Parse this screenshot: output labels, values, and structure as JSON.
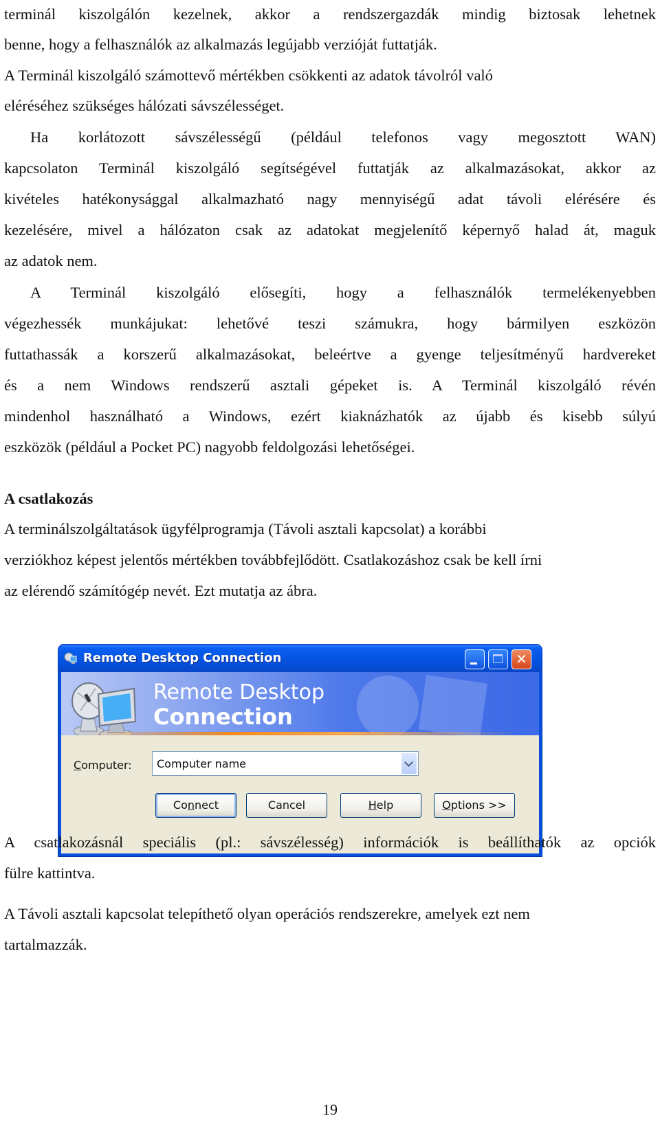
{
  "document": {
    "lines": [
      "terminál kiszolgálón kezelnek, akkor a rendszergazdák mindig biztosak lehetnek",
      "benne, hogy a felhasználók az alkalmazás legújabb verzióját futtatják.",
      "A Terminál kiszolgáló számottevő mértékben csökkenti az adatok távolról való",
      "eléréséhez szükséges hálózati sávszélességet.",
      "Ha korlátozott sávszélességű (például telefonos vagy megosztott WAN)",
      "kapcsolaton Terminál kiszolgáló segítségével futtatják az alkalmazásokat, akkor az",
      "kivételes hatékonysággal alkalmazható nagy mennyiségű adat távoli elérésére és",
      "kezelésére, mivel a hálózaton csak az adatokat megjelenítő képernyő halad át, maguk",
      "az adatok nem.",
      "A Terminál kiszolgáló elősegíti, hogy a felhasználók termelékenyebben",
      "végezhessék munkájukat: lehetővé teszi számukra, hogy bármilyen eszközön",
      "futtathassák a korszerű alkalmazásokat, beleértve a gyenge teljesítményű hardvereket",
      "és a nem Windows rendszerű asztali gépeket is. A Terminál kiszolgáló révén",
      "mindenhol használható a Windows, ezért kiaknázhatók az újabb és kisebb súlyú",
      "eszközök (például a Pocket PC) nagyobb feldolgozási lehetőségei."
    ],
    "section_heading": "A csatlakozás",
    "section_lines": [
      "A terminálszolgáltatások ügyfélprogramja (Távoli asztali kapcsolat) a korábbi",
      "verziókhoz képest jelentős mértékben továbbfejlődött. Csatlakozáshoz csak be kell írni",
      "az elérendő számítógép nevét. Ezt mutatja az ábra."
    ],
    "after_figure_lines": [
      "A csatlakozásnál speciális (pl.: sávszélesség) információk is beállíthatók az opciók",
      "fülre kattintva.",
      "A Távoli asztali kapcsolat telepíthető olyan operációs rendszerekre, amelyek ezt nem",
      "tartalmazzák."
    ],
    "page_number": "19"
  },
  "dialog": {
    "title": "Remote Desktop Connection",
    "banner_line1": "Remote Desktop",
    "banner_line2": "Connection",
    "computer_label_mnemonic": "C",
    "computer_label_rest": "omputer:",
    "computer_value": "Computer name",
    "buttons": {
      "connect_a": "Co",
      "connect_m": "n",
      "connect_b": "nect",
      "cancel": "Cancel",
      "help_m": "H",
      "help_b": "elp",
      "options_m": "O",
      "options_b": "ptions >>"
    },
    "colors": {
      "titlebar": "#0552e0",
      "close_button": "#d6471c",
      "body": "#ece9d8",
      "banner_stripe": "#f28b1f"
    }
  }
}
